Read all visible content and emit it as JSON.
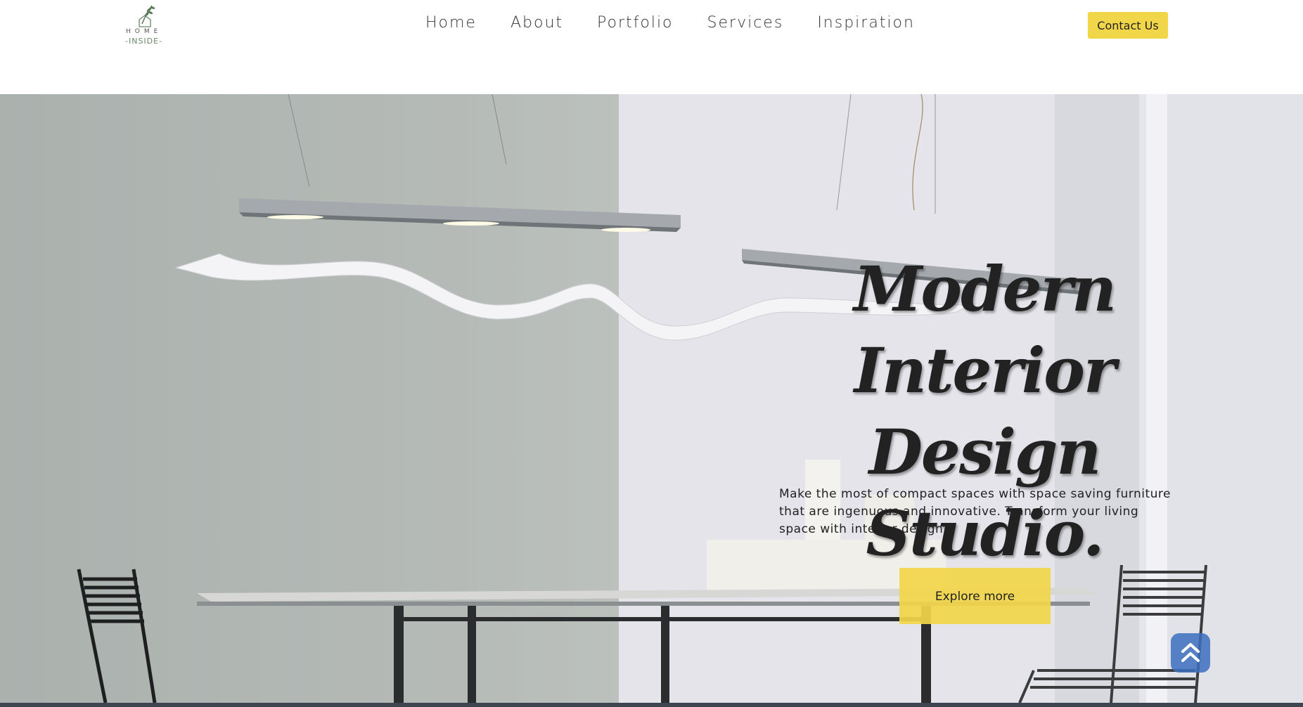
{
  "header": {
    "logo": {
      "line1": "HOME",
      "line2": "-INSIDE-"
    },
    "nav": [
      "Home",
      "About",
      "Portfolio",
      "Services",
      "Inspiration"
    ],
    "contact_label": "Contact Us"
  },
  "hero": {
    "title_line1": "Modern Interior",
    "title_line2": "Design Studio.",
    "description": "Make the most of compact spaces with space saving furniture that are ingenuous and innovative. Transform your living space with interior design.",
    "cta_label": "Explore more"
  },
  "colors": {
    "accent": "#f2d649",
    "scroll_button": "#3c6ebe",
    "text_dark": "#222222"
  },
  "icons": {
    "logo": "leaf-house-logo-icon",
    "scroll_top": "chevron-double-up-icon"
  }
}
